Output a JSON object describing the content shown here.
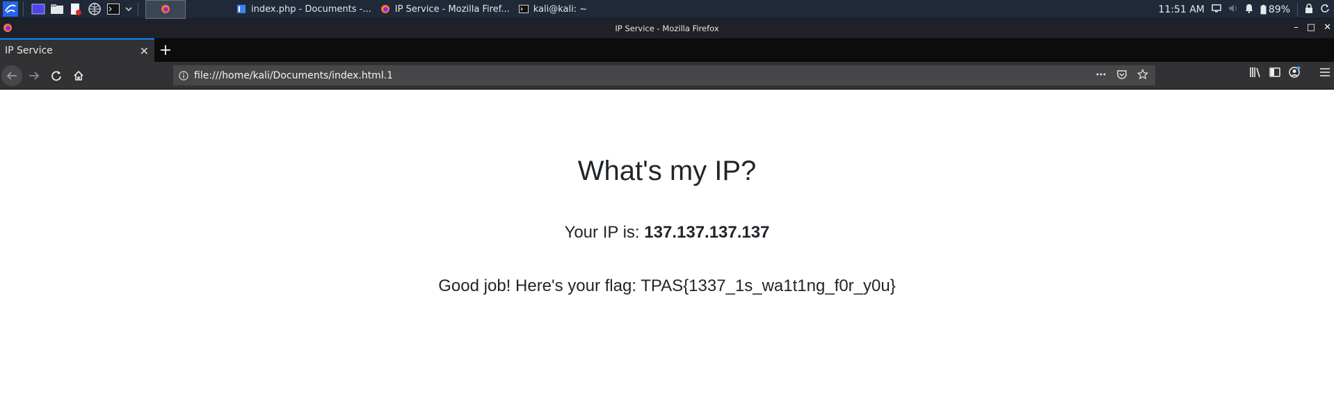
{
  "panel": {
    "tasks": [
      {
        "label": "index.php - Documents -...",
        "icon": "mousepad-icon"
      },
      {
        "label": "IP Service - Mozilla Firef...",
        "icon": "firefox-icon"
      },
      {
        "label": "kali@kali: ~",
        "icon": "terminal-icon"
      }
    ],
    "clock": "11:51 AM",
    "battery": "89%"
  },
  "window": {
    "title": "IP Service - Mozilla Firefox"
  },
  "tabs": [
    {
      "label": "IP Service",
      "active": true
    }
  ],
  "urlbar": {
    "url": "file:///home/kali/Documents/index.html.1"
  },
  "page": {
    "heading": "What's my IP?",
    "ip_prefix": "Your IP is: ",
    "ip_value": "137.137.137.137",
    "flag_text": "Good job! Here's your flag: TPAS{1337_1s_wa1t1ng_f0r_y0u}"
  },
  "colors": {
    "panel_bg": "#1f2937",
    "tab_accent": "#0a84ff",
    "toolbar_bg": "#323234"
  }
}
